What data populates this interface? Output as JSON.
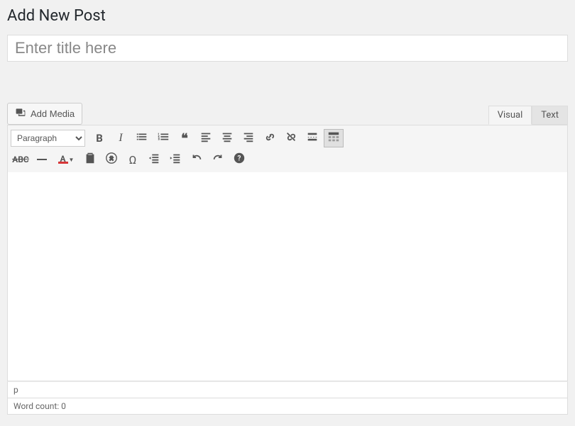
{
  "page_title": "Add New Post",
  "title_placeholder": "Enter title here",
  "add_media_label": "Add Media",
  "tabs": {
    "visual": "Visual",
    "text": "Text"
  },
  "format_select": "Paragraph",
  "status": {
    "path": "p",
    "word_count_label": "Word count: 0"
  },
  "icons": {
    "media": "media-icon",
    "bold": "bold-icon",
    "italic": "italic-icon",
    "bullist": "bullet-list-icon",
    "numlist": "number-list-icon",
    "quote": "blockquote-icon",
    "alignleft": "align-left-icon",
    "aligncenter": "align-center-icon",
    "alignright": "align-right-icon",
    "link": "link-icon",
    "unlink": "unlink-icon",
    "more": "read-more-icon",
    "toolbar_toggle": "toolbar-toggle-icon",
    "strike": "strikethrough-icon",
    "hr": "horizontal-rule-icon",
    "textcolor": "text-color-icon",
    "paste": "paste-text-icon",
    "clear": "clear-formatting-icon",
    "char": "special-character-icon",
    "outdent": "outdent-icon",
    "indent": "indent-icon",
    "undo": "undo-icon",
    "redo": "redo-icon",
    "help": "help-icon"
  }
}
